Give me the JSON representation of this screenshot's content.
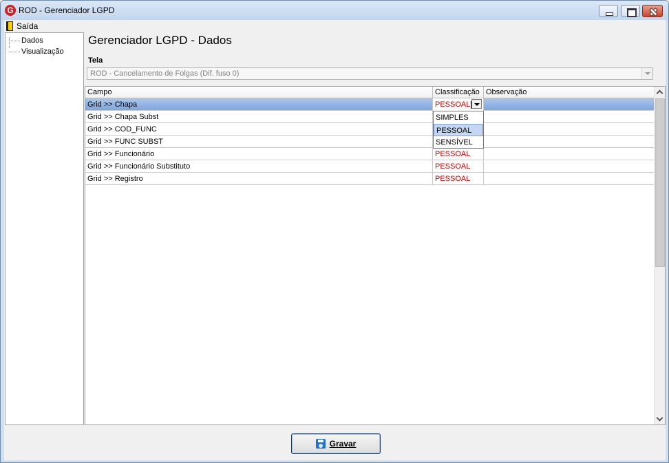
{
  "window": {
    "title": "ROD - Gerenciador LGPD",
    "logo_letter": "G"
  },
  "menu": {
    "exit_label": "Saída"
  },
  "sidebar": {
    "items": [
      {
        "label": "Dados"
      },
      {
        "label": "Visualização"
      }
    ]
  },
  "main": {
    "page_title": "Gerenciador LGPD - Dados",
    "tela_label": "Tela",
    "tela_value": "ROD - Cancelamento de Folgas (Dif. fuso 0)"
  },
  "grid": {
    "headers": {
      "campo": "Campo",
      "classificacao": "Classificação",
      "observacao": "Observação"
    },
    "rows": [
      {
        "campo": "Grid >> Chapa",
        "classificacao": "PESSOAL",
        "observacao": ""
      },
      {
        "campo": "Grid >> Chapa Subst",
        "classificacao": "",
        "observacao": ""
      },
      {
        "campo": "Grid >> COD_FUNC",
        "classificacao": "",
        "observacao": ""
      },
      {
        "campo": "Grid >> FUNC SUBST",
        "classificacao": "",
        "observacao": ""
      },
      {
        "campo": "Grid >> Funcionário",
        "classificacao": "PESSOAL",
        "observacao": ""
      },
      {
        "campo": "Grid >> Funcionário Substituto",
        "classificacao": "PESSOAL",
        "observacao": ""
      },
      {
        "campo": "Grid >> Registro",
        "classificacao": "PESSOAL",
        "observacao": ""
      }
    ],
    "dropdown_options": [
      "SIMPLES",
      "PESSOAL",
      "SENSÍVEL"
    ],
    "dropdown_highlighted": "PESSOAL"
  },
  "footer": {
    "save_label": "Gravar"
  },
  "colors": {
    "classification_text": "#cc0000",
    "selection": "#7fa6dc"
  }
}
